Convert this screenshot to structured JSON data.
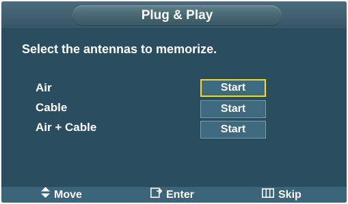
{
  "title": "Plug & Play",
  "instruction": "Select the antennas to memorize.",
  "options": [
    {
      "label": "Air",
      "button": "Start",
      "selected": true
    },
    {
      "label": "Cable",
      "button": "Start",
      "selected": false
    },
    {
      "label": "Air + Cable",
      "button": "Start",
      "selected": false
    }
  ],
  "footer": {
    "move_label": "Move",
    "enter_label": "Enter",
    "skip_label": "Skip"
  },
  "colors": {
    "background": "#2b4d60",
    "selection_border": "#ffd820",
    "text": "#ffffff"
  }
}
